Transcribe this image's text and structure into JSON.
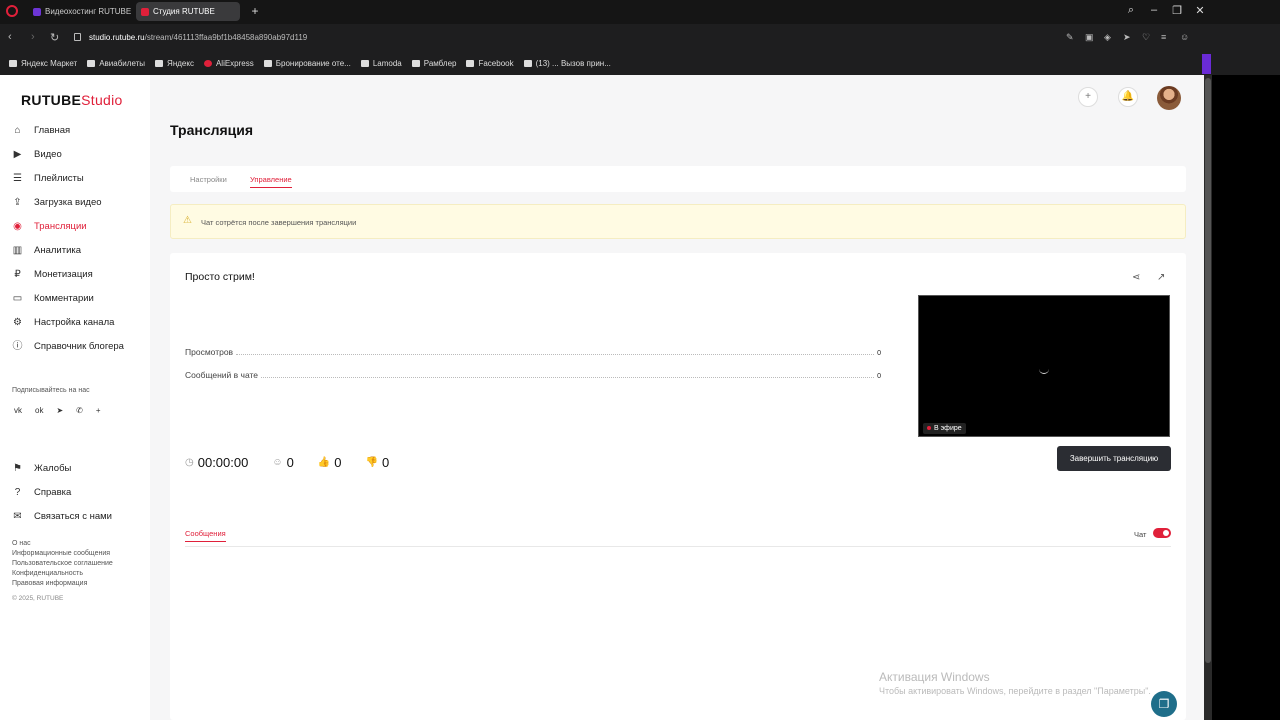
{
  "browser": {
    "tabs": [
      {
        "label": "Видеохостинг RUTUBE. С"
      },
      {
        "label": "Студия RUTUBE"
      }
    ],
    "url_host": "studio.rutube.ru",
    "url_path": "/stream/461113ffaa9bf1b48458a890ab97d119",
    "bookmarks": [
      "Яндекс Маркет",
      "Авиабилеты",
      "Яндекс",
      "AliExpress",
      "Бронирование оте...",
      "Lamoda",
      "Рамблер",
      "Facebook",
      "(13) ... Вызов прин..."
    ]
  },
  "brand": {
    "logo_main": "RUTUBE",
    "logo_sub": "Studio",
    "accent": "#e0203a"
  },
  "sidebar": {
    "items": [
      {
        "label": "Главная",
        "icon": "home-icon",
        "glyph": "⌂"
      },
      {
        "label": "Видео",
        "icon": "video-icon",
        "glyph": "▶"
      },
      {
        "label": "Плейлисты",
        "icon": "playlist-icon",
        "glyph": "☰"
      },
      {
        "label": "Загрузка видео",
        "icon": "upload-icon",
        "glyph": "⇪"
      },
      {
        "label": "Трансляции",
        "icon": "broadcast-icon",
        "glyph": "◉"
      },
      {
        "label": "Аналитика",
        "icon": "analytics-icon",
        "glyph": "▥"
      },
      {
        "label": "Монетизация",
        "icon": "money-icon",
        "glyph": "₽"
      },
      {
        "label": "Комментарии",
        "icon": "comments-icon",
        "glyph": "▭"
      },
      {
        "label": "Настройка канала",
        "icon": "gear-icon",
        "glyph": "⚙"
      },
      {
        "label": "Справочник блогера",
        "icon": "info-icon",
        "glyph": "ⓘ"
      }
    ],
    "follow_label": "Подписывайтесь на нас",
    "socials": [
      "vk-icon",
      "ok-icon",
      "telegram-icon",
      "viber-icon",
      "plus-icon"
    ],
    "social_glyphs": [
      "vk",
      "ok",
      "➤",
      "✆",
      "+"
    ],
    "secondary": [
      {
        "label": "Жалобы",
        "icon": "flag-icon",
        "glyph": "⚑"
      },
      {
        "label": "Справка",
        "icon": "help-icon",
        "glyph": "?"
      },
      {
        "label": "Связаться с нами",
        "icon": "mail-icon",
        "glyph": "✉"
      }
    ],
    "footer_links": [
      "О нас",
      "Информационные сообщения",
      "Пользовательское соглашение",
      "Конфиденциальность",
      "Правовая информация"
    ],
    "copyright": "© 2025, RUTUBE"
  },
  "header": {
    "plus_glyph": "+",
    "bell_glyph": "🔔"
  },
  "main": {
    "title": "Трансляция",
    "tabs": [
      {
        "label": "Настройки"
      },
      {
        "label": "Управление"
      }
    ],
    "warning": "Чат сотрётся после завершения трансляции",
    "stream": {
      "name": "Просто стрим!",
      "stats": [
        {
          "label": "Просмотров",
          "value": "0"
        },
        {
          "label": "Сообщений в чате",
          "value": "0"
        }
      ],
      "live_label": "В эфире",
      "duration": "00:00:00",
      "viewers": "0",
      "likes": "0",
      "dislikes": "0",
      "end_button": "Завершить трансляцию"
    },
    "chat": {
      "tab_label": "Сообщения",
      "toggle_label": "Чат",
      "toggle_on": true
    }
  },
  "os_overlay": {
    "title": "Активация Windows",
    "subtitle": "Чтобы активировать Windows, перейдите в раздел \"Параметры\"."
  }
}
